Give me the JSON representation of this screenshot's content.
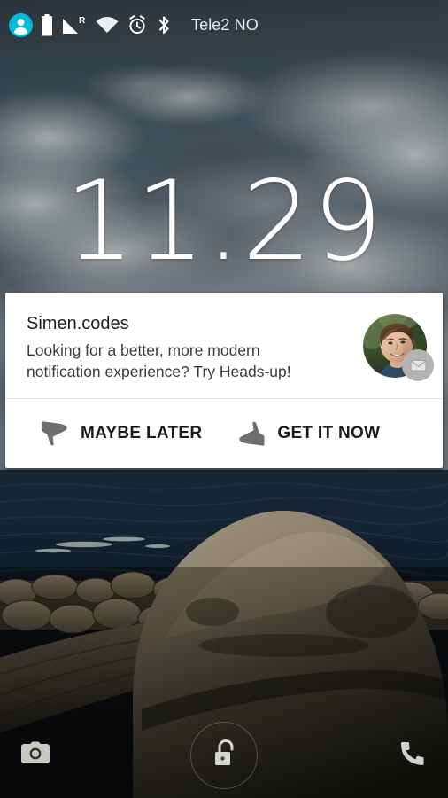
{
  "status_bar": {
    "icons": [
      {
        "name": "account-icon",
        "label": "account"
      },
      {
        "name": "battery-icon",
        "label": "battery-full"
      },
      {
        "name": "cell-signal-roaming-icon",
        "label": "signal-roaming"
      },
      {
        "name": "wifi-icon",
        "label": "wifi"
      },
      {
        "name": "alarm-icon",
        "label": "alarm-set"
      },
      {
        "name": "bluetooth-icon",
        "label": "bluetooth"
      }
    ],
    "roaming_indicator": "R",
    "carrier": "Tele2 NO",
    "accent_color": "#00BCD4",
    "icon_color": "#FFFFFF",
    "text_color": "#E8EBEC"
  },
  "lockscreen": {
    "clock": "11.29",
    "clock_color": "#FFFFFF"
  },
  "notification": {
    "app_title": "Simen.codes",
    "message": "Looking for a better, more modern notification experience? Try Heads-up!",
    "card_color": "#FFFFFF",
    "avatar": {
      "name": "contact-avatar",
      "badge_icon": "envelope-icon",
      "badge_color": "#B3B3B3"
    },
    "actions": [
      {
        "icon": "thumb-down-icon",
        "label": "MAYBE LATER"
      },
      {
        "icon": "thumb-up-icon",
        "label": "GET IT NOW"
      }
    ]
  },
  "shortcuts": {
    "camera": {
      "icon": "camera-icon",
      "label": "Camera"
    },
    "unlock": {
      "icon": "unlock-icon",
      "label": "Unlock"
    },
    "phone": {
      "icon": "phone-icon",
      "label": "Phone"
    }
  }
}
